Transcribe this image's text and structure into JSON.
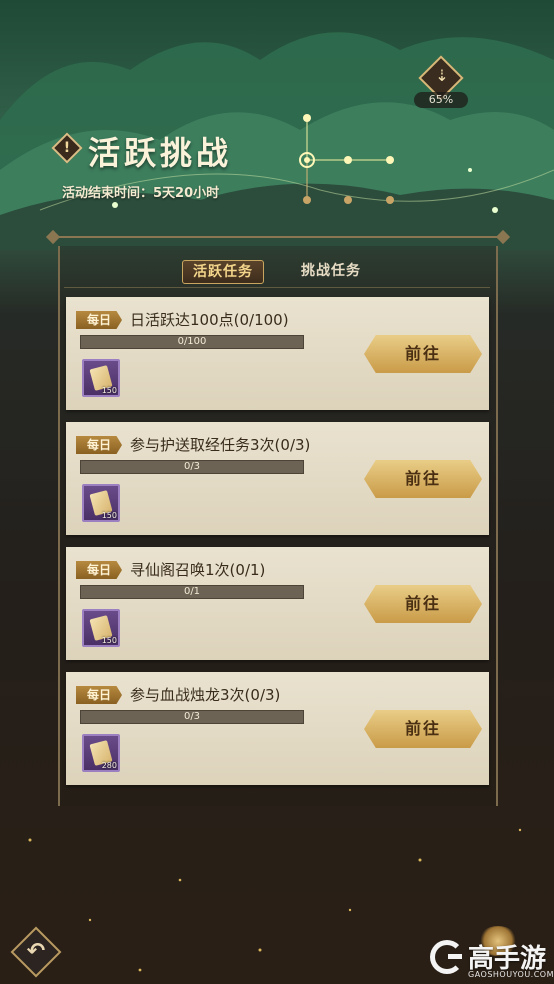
{
  "header": {
    "title": "活跃挑战",
    "end_time": "活动结束时间：5天20小时",
    "download_percent": "65%",
    "title_mark": "!"
  },
  "tabs": [
    {
      "label": "活跃任务",
      "active": true
    },
    {
      "label": "挑战任务",
      "active": false
    }
  ],
  "tasks": [
    {
      "tag": "每日",
      "text": "日活跃达100点(0/100)",
      "progress_label": "0/100",
      "progress": 0,
      "reward_icon": "scroll-icon",
      "reward_count": "150",
      "button": "前往"
    },
    {
      "tag": "每日",
      "text": "参与护送取经任务3次(0/3)",
      "progress_label": "0/3",
      "progress": 0,
      "reward_icon": "scroll-icon",
      "reward_count": "150",
      "button": "前往"
    },
    {
      "tag": "每日",
      "text": "寻仙阁召唤1次(0/1)",
      "progress_label": "0/1",
      "progress": 0,
      "reward_icon": "scroll-icon",
      "reward_count": "150",
      "button": "前往"
    },
    {
      "tag": "每日",
      "text": "参与血战烛龙3次(0/3)",
      "progress_label": "0/3",
      "progress": 0,
      "reward_icon": "scroll-icon",
      "reward_count": "280",
      "button": "前往"
    }
  ],
  "nav": {
    "back_icon": "back-arrow-icon",
    "back_glyph": "↶"
  },
  "watermark": {
    "brand": "高手游",
    "domain": "GAOSHOUYOU.COM"
  },
  "colors": {
    "accent_gold": "#c99b48",
    "card_bg": "#e9e2cf",
    "reward_purple": "#6a4b8a"
  }
}
